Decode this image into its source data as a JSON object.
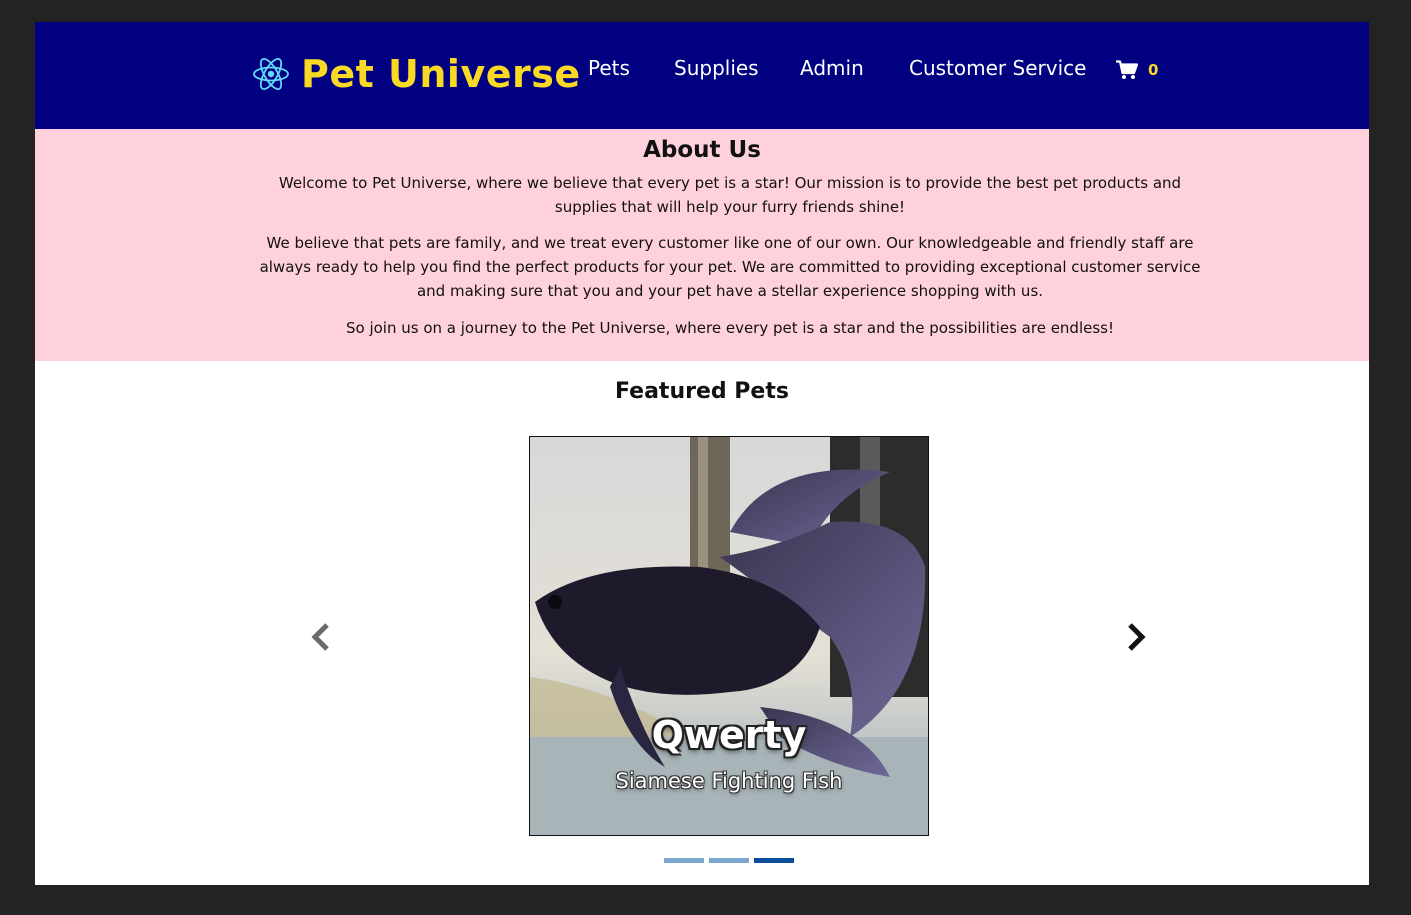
{
  "header": {
    "brand": "Pet Universe",
    "logo_icon": "react-atom-icon",
    "nav": [
      {
        "label": "Pets"
      },
      {
        "label": "Supplies"
      },
      {
        "label": "Admin"
      },
      {
        "label": "Customer Service"
      }
    ],
    "cart": {
      "icon": "shopping-cart-icon",
      "count": "0"
    },
    "colors": {
      "background": "#000080",
      "brand": "#f9d923",
      "link": "#ffffff"
    }
  },
  "about": {
    "title": "About Us",
    "paragraphs": [
      "Welcome to Pet Universe, where we believe that every pet is a star! Our mission is to provide the best pet products and supplies that will help your furry friends shine!",
      "We believe that pets are family, and we treat every customer like one of our own. Our knowledgeable and friendly staff are always ready to help you find the perfect products for your pet. We are committed to providing exceptional customer service and making sure that you and your pet have a stellar experience shopping with us.",
      "So join us on a journey to the Pet Universe, where every pet is a star and the possibilities are endless!"
    ],
    "background": "#ffd1dc"
  },
  "featured": {
    "title": "Featured Pets",
    "slide": {
      "name": "Qwerty",
      "breed": "Siamese Fighting Fish",
      "image_icon": "betta-fish-photo"
    },
    "prev_icon": "chevron-left-icon",
    "next_icon": "chevron-right-icon",
    "indicators": [
      {
        "active": false
      },
      {
        "active": false
      },
      {
        "active": true
      }
    ],
    "indicator_colors": {
      "inactive": "#7aa6d0",
      "active": "#0b4f9c"
    }
  }
}
